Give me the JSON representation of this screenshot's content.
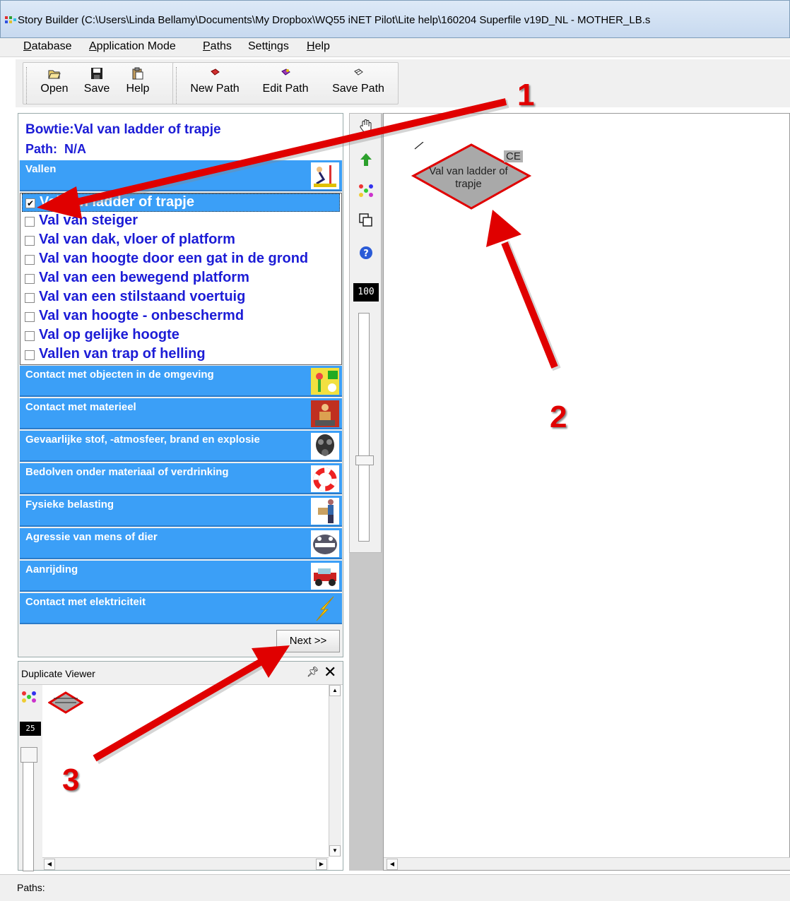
{
  "window": {
    "title": "Story Builder (C:\\Users\\Linda Bellamy\\Documents\\My Dropbox\\WQ55 iNET Pilot\\Lite help\\160204 Superfile v19D_NL - MOTHER_LB.s"
  },
  "menu": [
    {
      "label": "Database",
      "ul": "D",
      "rest": "atabase"
    },
    {
      "label": "Application Mode",
      "ul": "A",
      "rest": "pplication Mode"
    },
    {
      "label": "Paths",
      "ul": "P",
      "rest": "aths"
    },
    {
      "label": "Settings",
      "pre": "Sett",
      "ul": "i",
      "rest": "ngs"
    },
    {
      "label": "Help",
      "ul": "H",
      "rest": "elp"
    }
  ],
  "toolbar": {
    "open": "Open",
    "save": "Save",
    "help": "Help",
    "new_path": "New Path",
    "edit_path": "Edit Path",
    "save_path": "Save Path"
  },
  "bowtie": {
    "line1": "Bowtie:Val van ladder of trapje",
    "path_label": "Path:",
    "path_value": "N/A"
  },
  "categories": [
    {
      "label": "Vallen",
      "icon": "falling-person-icon"
    },
    {
      "label": "Contact met objecten in de omgeving",
      "icon": "objects-icon"
    },
    {
      "label": "Contact met materieel",
      "icon": "machinery-icon"
    },
    {
      "label": "Gevaarlijke stof, -atmosfeer, brand en explosie",
      "icon": "gas-mask-icon"
    },
    {
      "label": "Bedolven onder materiaal of verdrinking",
      "icon": "lifebuoy-icon"
    },
    {
      "label": "Fysieke belasting",
      "icon": "lifting-icon"
    },
    {
      "label": "Agressie van mens of dier",
      "icon": "shark-icon"
    },
    {
      "label": "Aanrijding",
      "icon": "jeep-icon"
    },
    {
      "label": "Contact met elektriciteit",
      "icon": "lightning-icon"
    }
  ],
  "subitems": [
    {
      "label": "Val van ladder of trapje",
      "checked": true
    },
    {
      "label": "Val van steiger",
      "checked": false
    },
    {
      "label": "Val van dak, vloer of platform",
      "checked": false
    },
    {
      "label": "Val van hoogte door een gat in de grond",
      "checked": false
    },
    {
      "label": "Val van een bewegend platform",
      "checked": false
    },
    {
      "label": "Val van een stilstaand voertuig",
      "checked": false
    },
    {
      "label": "Val van hoogte - onbeschermd",
      "checked": false
    },
    {
      "label": "Val op gelijke hoogte",
      "checked": false
    },
    {
      "label": "Vallen van trap of helling",
      "checked": false
    }
  ],
  "next_button": "Next >>",
  "duplicate_viewer": {
    "title": "Duplicate Viewer",
    "zoom": "25"
  },
  "canvas": {
    "zoom": "100",
    "node_label": "Val van ladder of trapje",
    "node_tag": "CE"
  },
  "statusbar": {
    "text": "Paths:"
  },
  "callouts": [
    "1",
    "2",
    "3"
  ],
  "colors": {
    "category_bg": "#3b9ff7",
    "link_blue": "#1c1cd6",
    "arrow_red": "#e00000",
    "node_gray": "#a9a9a9",
    "node_border": "#e00000"
  }
}
